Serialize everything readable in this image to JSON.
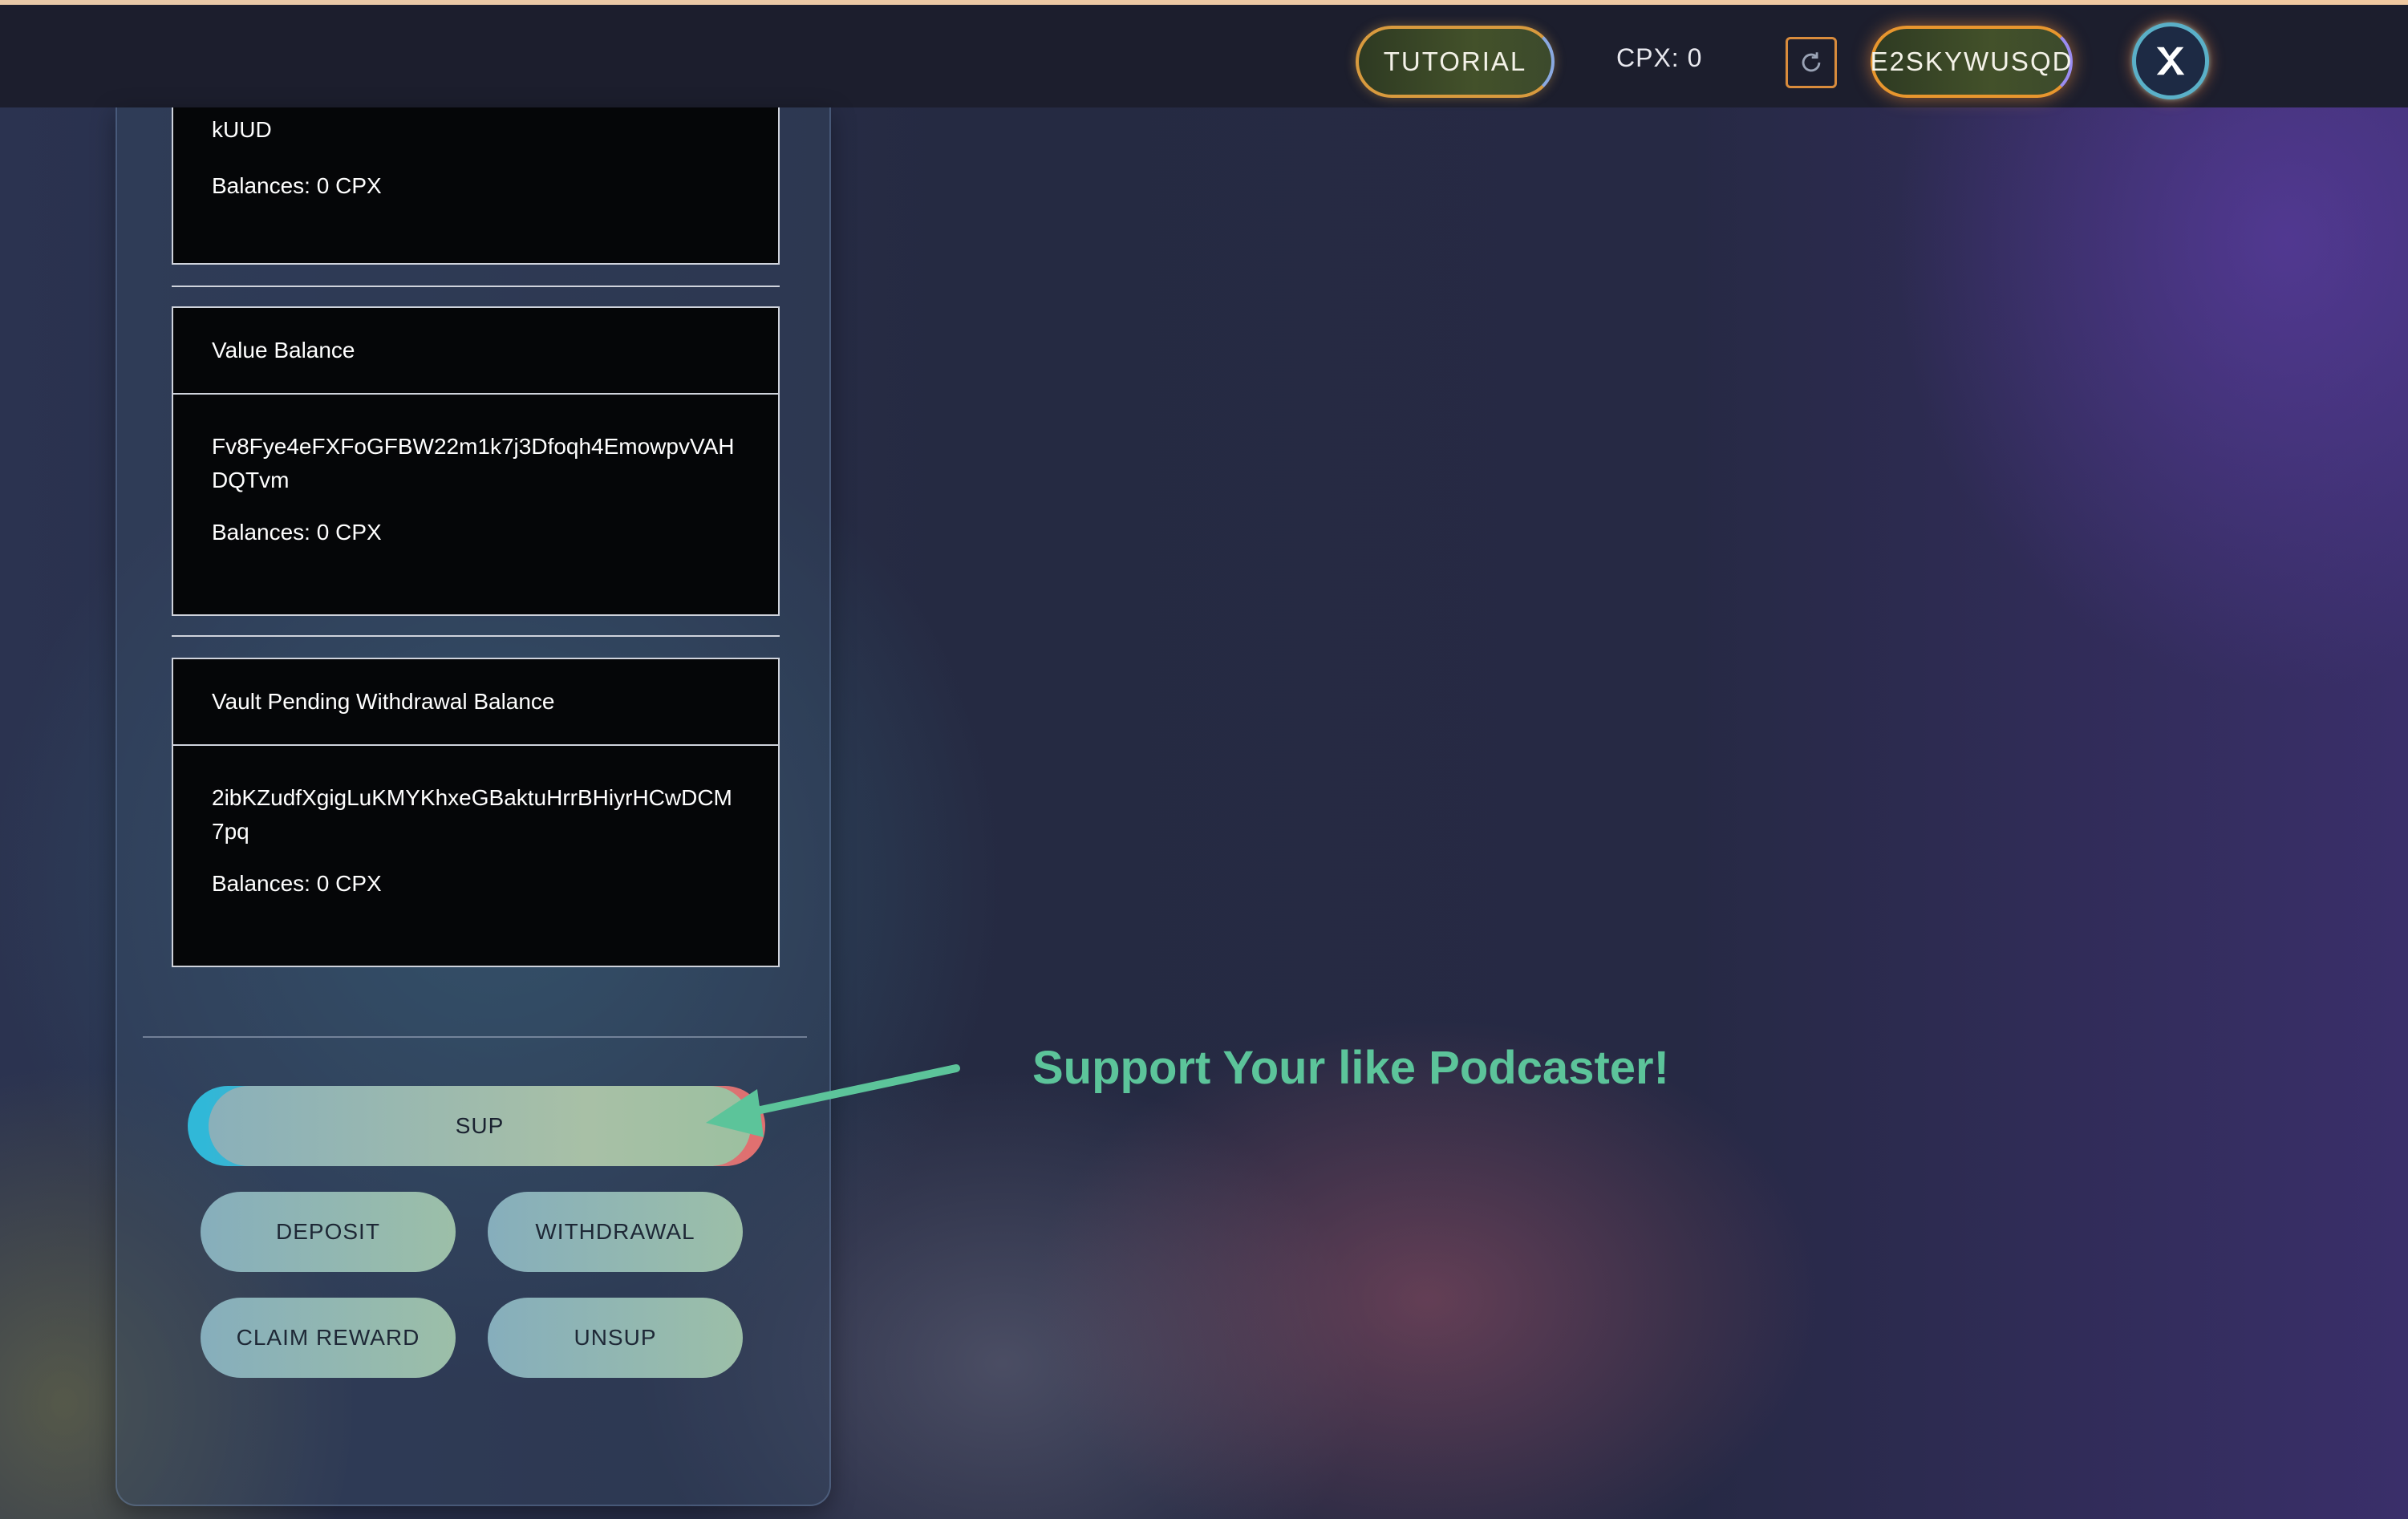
{
  "header": {
    "tutorial_label": "TUTORIAL",
    "cpx_balance": "CPX: 0",
    "wallet_label": "E2SKYWUSQD"
  },
  "cards": {
    "top_fragment": {
      "address_tail": "kUUD",
      "balance": "Balances: 0 CPX"
    },
    "value_balance": {
      "title": "Value Balance",
      "address": "Fv8Fye4eFXFoGFBW22m1k7j3Dfoqh4EmowpvVAHDQTvm",
      "balance": "Balances: 0 CPX"
    },
    "vault_pending": {
      "title": "Vault Pending Withdrawal Balance",
      "address": "2ibKZudfXgigLuKMYKhxeGBaktuHrrBHiyrHCwDCM7pq",
      "balance": "Balances: 0 CPX"
    }
  },
  "actions": {
    "sup": "SUP",
    "deposit": "DEPOSIT",
    "withdrawal": "WITHDRAWAL",
    "claim_reward": "CLAIM REWARD",
    "unsup": "UNSUP"
  },
  "annotation": {
    "callout_text": "Support Your like Podcaster!"
  },
  "colors": {
    "callout": "#5cc49a",
    "card_bg": "#050608",
    "topbar_bg": "#1c1e2d",
    "accent_orange": "#e0a24c"
  },
  "icons": {
    "refresh": "refresh-icon",
    "close": "x-logo-icon"
  }
}
